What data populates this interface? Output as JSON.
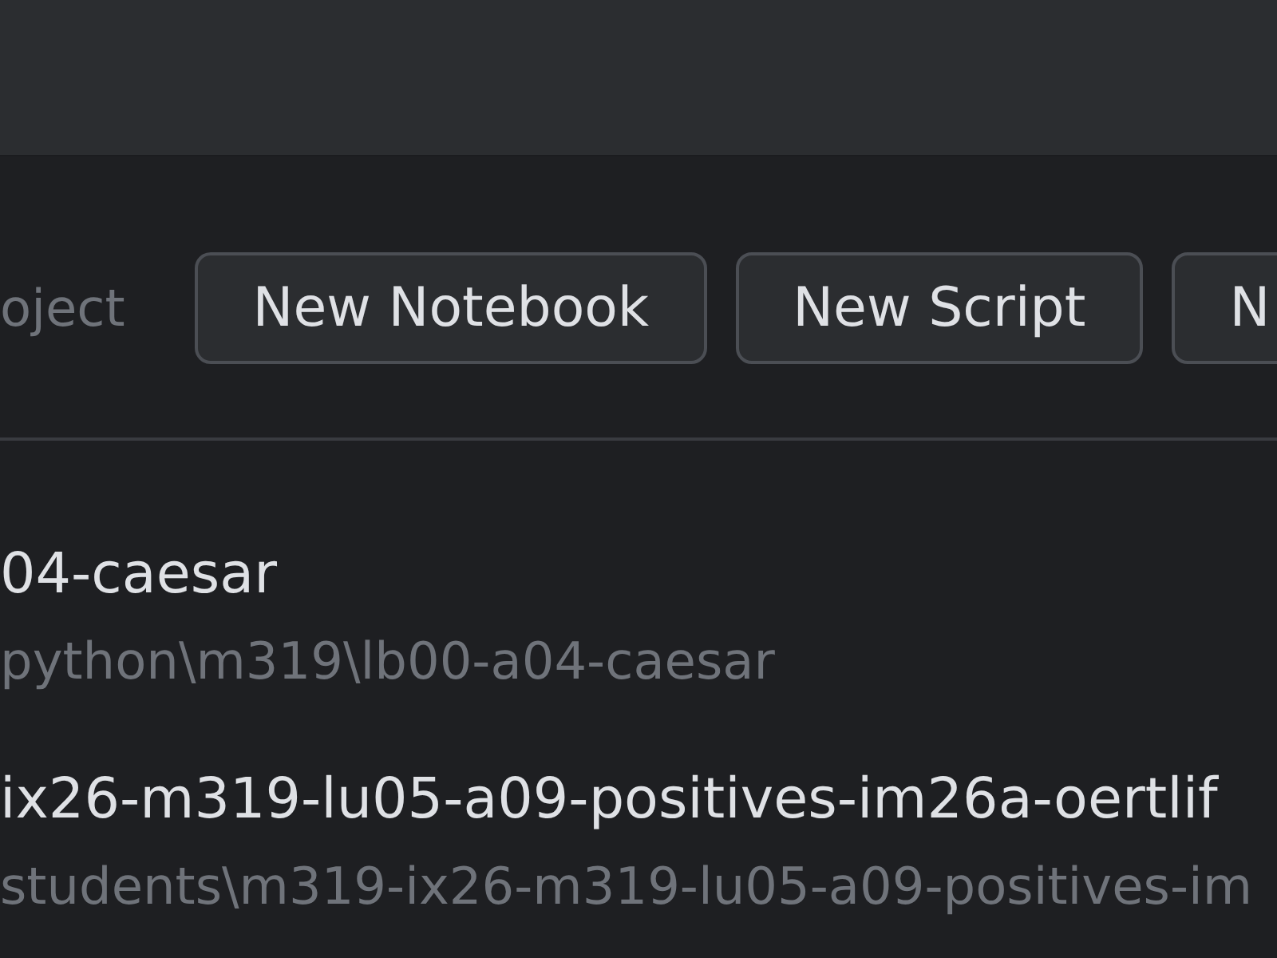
{
  "toolbar": {
    "label": "oject",
    "buttons": [
      {
        "label": "New Notebook"
      },
      {
        "label": "New Script"
      },
      {
        "label": "N"
      }
    ]
  },
  "recent_projects": [
    {
      "name": "04-caesar",
      "path": "python\\m319\\lb00-a04-caesar"
    },
    {
      "name": "ix26-m319-lu05-a09-positives-im26a-oertlif",
      "path": "students\\m319-ix26-m319-lu05-a09-positives-im"
    }
  ]
}
